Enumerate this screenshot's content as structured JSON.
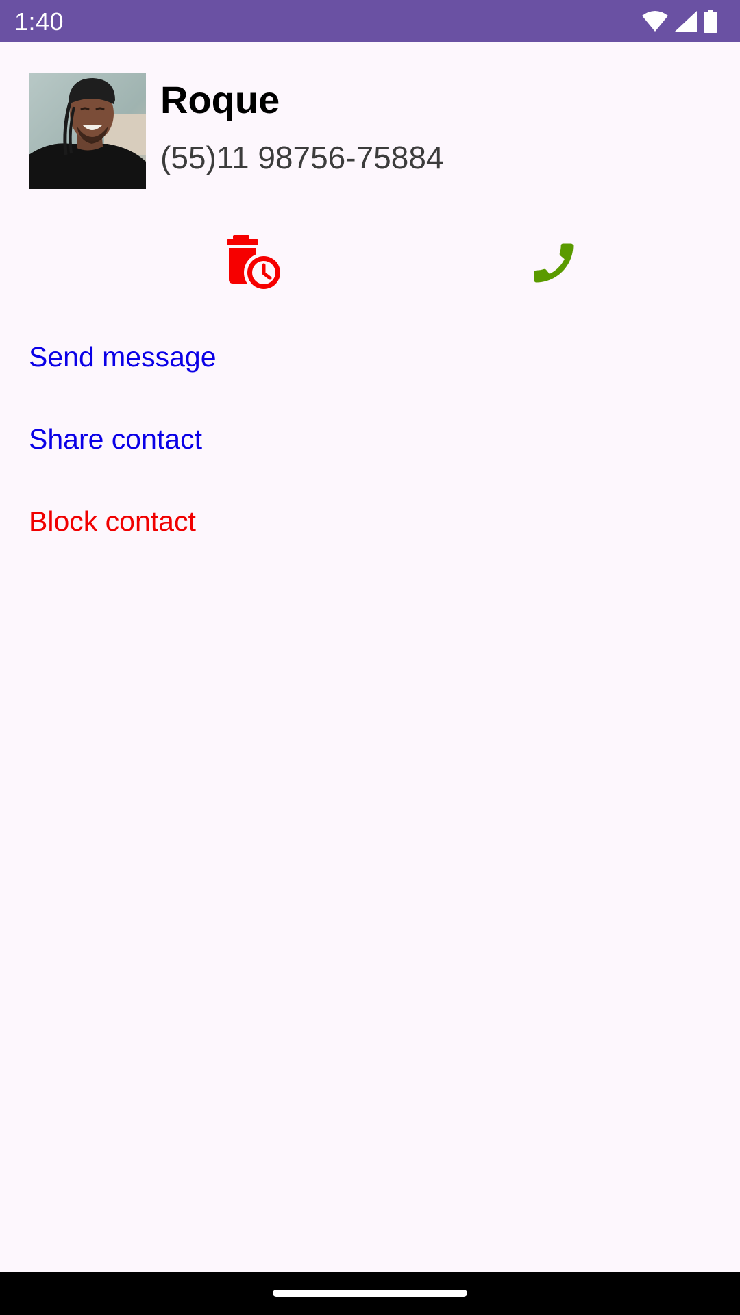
{
  "status_bar": {
    "time": "1:40",
    "icons": [
      "wifi-icon",
      "cell-signal-icon",
      "battery-icon"
    ],
    "background": "#6a51a3"
  },
  "contact": {
    "name": "Roque",
    "phone": "(55)11 98756-75884"
  },
  "actions": {
    "delete_icon": "delete-clock-icon",
    "delete_color": "#f60000",
    "call_icon": "phone-icon",
    "call_color": "#5a9a00"
  },
  "options": {
    "send_message": "Send message",
    "share_contact": "Share contact",
    "block_contact": "Block contact",
    "link_color": "#0a00e6",
    "danger_color": "#f00000"
  }
}
